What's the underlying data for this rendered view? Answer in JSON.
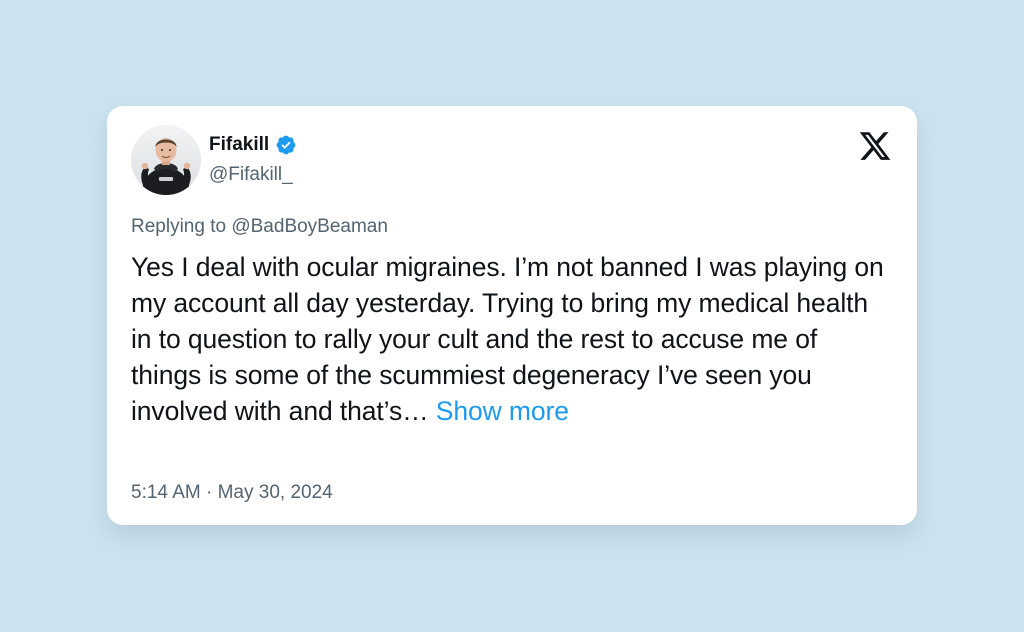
{
  "author": {
    "display_name": "Fifakill",
    "handle": "@Fifakill_",
    "verified": true
  },
  "reply": {
    "prefix": "Replying to ",
    "to_handle": "@BadBoyBeaman"
  },
  "tweet": {
    "text": "Yes I deal with ocular migraines. I’m not banned I was playing on my account all day yesterday. Trying to bring my medical health in to question to rally your cult and the rest to accuse me of things is some of the scummiest degeneracy I’ve seen you involved with and that’s… ",
    "show_more_label": "Show more"
  },
  "meta": {
    "timestamp": "5:14 AM · May 30, 2024"
  },
  "icons": {
    "logo": "x-logo-icon",
    "verified": "verified-badge-icon"
  },
  "colors": {
    "background": "#cce3ef",
    "card": "#ffffff",
    "primary_text": "#0f1419",
    "secondary_text": "#536471",
    "link": "#1d9bf0",
    "verified": "#1d9bf0"
  }
}
